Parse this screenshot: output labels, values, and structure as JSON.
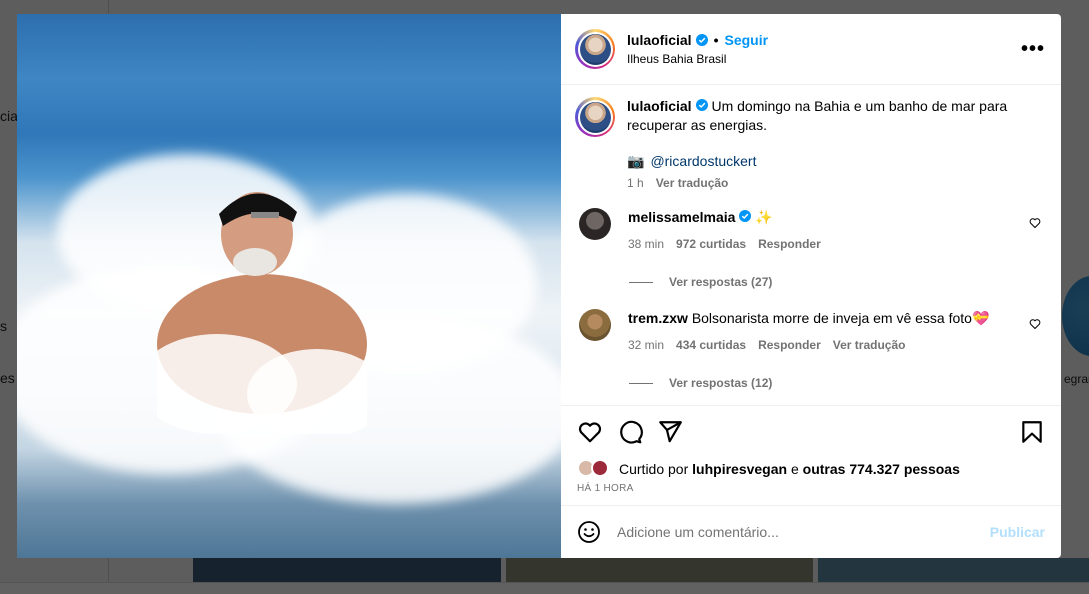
{
  "background": {
    "fragments": [
      "cia",
      "s",
      "es"
    ],
    "telegram_label": "egran"
  },
  "post": {
    "username": "lulaoficial",
    "follow_label": "Seguir",
    "dot": "•",
    "location": "Ilheus Bahia Brasil",
    "more_label": "•••",
    "caption": "Um domingo na Bahia e um banho de mar para recuperar as energias.",
    "credit": "@ricardostuckert",
    "credit_icon": "📷",
    "time": "1 h",
    "see_translation": "Ver tradução"
  },
  "comments": [
    {
      "username": "melissamelmaia",
      "text": "✨",
      "time": "38 min",
      "likes": "972 curtidas",
      "reply": "Responder",
      "translate": "",
      "replies": "Ver respostas (27)"
    },
    {
      "username": "trem.zxw",
      "text": "Bolsonarista morre de inveja em vê essa foto💝",
      "time": "32 min",
      "likes": "434 curtidas",
      "reply": "Responder",
      "translate": "Ver tradução",
      "replies": "Ver respostas (12)"
    }
  ],
  "likes": {
    "prefix": "Curtido por",
    "user": "luhpiresvegan",
    "conj": "e",
    "others": "outras 774.327 pessoas"
  },
  "time_ago": "HÁ 1 HORA",
  "add_comment": {
    "placeholder": "Adicione um comentário...",
    "publish_label": "Publicar"
  },
  "colors": {
    "accent": "#0095f6",
    "publish_disabled": "#b2dffc",
    "secondary_text": "#737373"
  }
}
